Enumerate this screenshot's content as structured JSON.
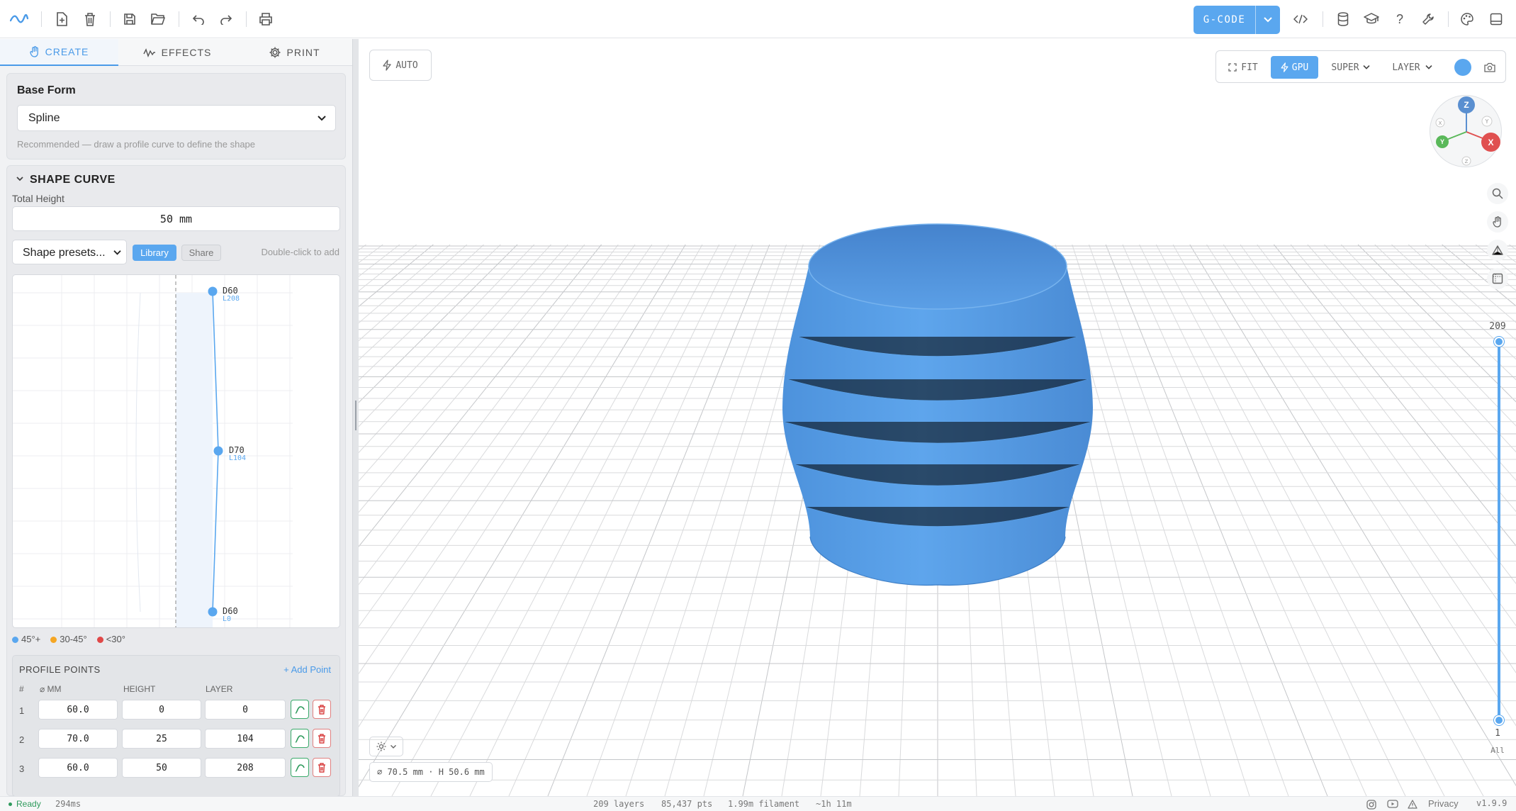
{
  "toolbar": {
    "gcode_label": "G-CODE"
  },
  "sidebar": {
    "tabs": [
      {
        "label": "CREATE",
        "active": true
      },
      {
        "label": "EFFECTS",
        "active": false
      },
      {
        "label": "PRINT",
        "active": false
      }
    ],
    "base_form": {
      "title": "Base Form",
      "selected": "Spline",
      "hint": "Recommended — draw a profile curve to define the shape"
    },
    "shape_curve": {
      "title": "SHAPE CURVE",
      "total_height_label": "Total Height",
      "total_height_value": "50 mm",
      "presets_label": "Shape presets...",
      "library_label": "Library",
      "share_label": "Share",
      "double_click_hint": "Double-click to add",
      "points_on_canvas": [
        {
          "d": "D60",
          "l": "L208"
        },
        {
          "d": "D70",
          "l": "L104"
        },
        {
          "d": "D60",
          "l": "L0"
        }
      ],
      "legend": [
        {
          "label": "45°+",
          "color": "#5aa7ef"
        },
        {
          "label": "30-45°",
          "color": "#f5a623"
        },
        {
          "label": "<30°",
          "color": "#e04848"
        }
      ]
    },
    "profile_points": {
      "title": "PROFILE POINTS",
      "add_label": "+ Add Point",
      "columns": [
        "#",
        "⌀ MM",
        "HEIGHT",
        "LAYER"
      ],
      "rows": [
        {
          "n": "1",
          "mm": "60.0",
          "height": "0",
          "layer": "0"
        },
        {
          "n": "2",
          "mm": "70.0",
          "height": "25",
          "layer": "104"
        },
        {
          "n": "3",
          "mm": "60.0",
          "height": "50",
          "layer": "208"
        }
      ]
    }
  },
  "viewport": {
    "auto_label": "AUTO",
    "fit_label": "FIT",
    "gpu_label": "GPU",
    "quality_label": "SUPER",
    "mode_label": "LAYER",
    "gizmo": {
      "z": "Z",
      "y": "Y",
      "x": "X"
    },
    "slider_top": "209",
    "slider_bottom": "1",
    "slider_all": "All",
    "dimensions": "⌀ 70.5 mm · H 50.6 mm",
    "model_color": "#5aa2ea"
  },
  "status": {
    "ready": "Ready",
    "time": "294ms",
    "layers": "209 layers",
    "pts": "85,437 pts",
    "filament": "1.99m filament",
    "duration": "~1h 11m",
    "privacy": "Privacy",
    "version": "v1.9.9"
  }
}
